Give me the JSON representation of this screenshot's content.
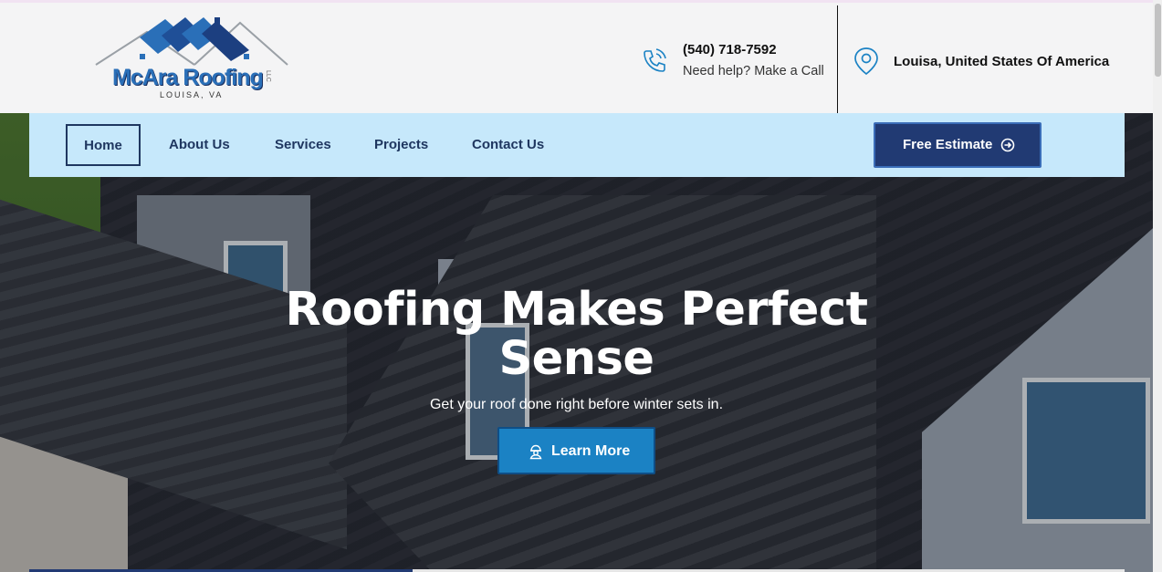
{
  "header": {
    "logo": {
      "name": "McAra Roofing",
      "suffix": "LLC",
      "location": "LOUISA, VA"
    },
    "contact": {
      "phone": "(540) 718-7592",
      "help": "Need help? Make a Call",
      "icon": "phone-call-icon"
    },
    "location": {
      "text": "Louisa, United States Of America",
      "icon": "map-pin-icon"
    }
  },
  "nav": {
    "items": [
      {
        "label": "Home",
        "active": true
      },
      {
        "label": "About Us"
      },
      {
        "label": "Services"
      },
      {
        "label": "Projects"
      },
      {
        "label": "Contact Us"
      }
    ],
    "cta": {
      "label": "Free Estimate",
      "icon": "arrow-circle-right-icon"
    }
  },
  "hero": {
    "title": "Roofing Makes Perfect Sense",
    "subtitle": "Get your roof done right before winter sets in.",
    "button": {
      "label": "Learn More",
      "icon": "worker-icon"
    }
  },
  "colors": {
    "nav_bg": "#c6e8fb",
    "navy": "#213a73",
    "accent_blue": "#1b82c4",
    "text_dark": "#1f3760"
  }
}
